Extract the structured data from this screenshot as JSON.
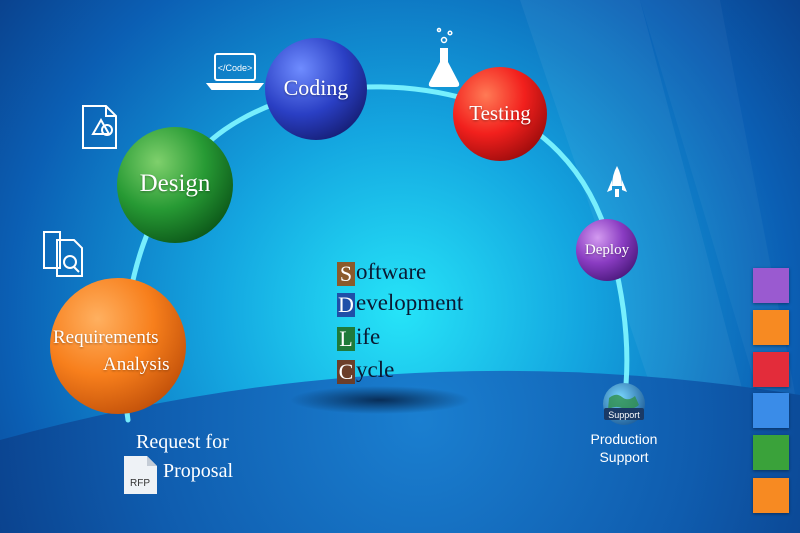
{
  "colors": {
    "background_dark": "#0a3f8a",
    "background_glow": "#1bd4f0",
    "arc": "#7cf3ff"
  },
  "stages": {
    "coding": "Coding",
    "testing": "Testing",
    "design": "Design",
    "deploy": "Deploy",
    "requirements_line1": "Requirements",
    "requirements_line2": "Analysis"
  },
  "acronym": [
    {
      "letter": "S",
      "rest": "oftware",
      "color": "#8b5a2b"
    },
    {
      "letter": "D",
      "rest": "evelopment",
      "color": "#1f4fa8"
    },
    {
      "letter": "L",
      "rest": "ife",
      "color": "#1f7a3a"
    },
    {
      "letter": "C",
      "rest": "ycle",
      "color": "#6b3e2a"
    }
  ],
  "request": {
    "line1": "Request for",
    "line2": "Proposal",
    "doc_label": "RFP"
  },
  "production": {
    "line1": "Production",
    "line2": "Support",
    "globe_label": "Support"
  },
  "icons": {
    "laptop_label": "</Code>",
    "laptop": "laptop-code-icon",
    "flask": "flask-icon",
    "rocket": "rocket-icon",
    "design_doc": "design-document-icon",
    "requirements_doc": "requirements-document-icon",
    "rfp_doc": "rfp-document-icon",
    "globe": "support-globe-icon"
  },
  "swatches": [
    "#9a5ad0",
    "#f78a22",
    "#e32c3a",
    "#3a8ce8",
    "#3aa23a",
    "#f78a22"
  ]
}
